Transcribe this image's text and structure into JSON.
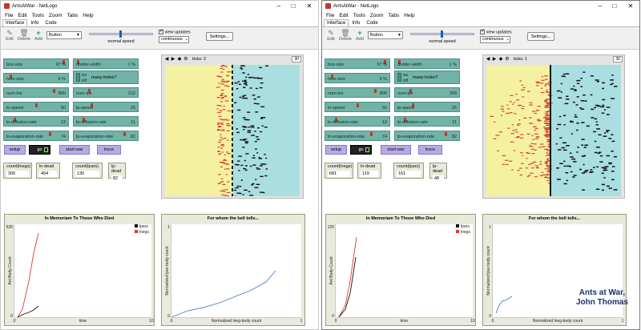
{
  "left": {
    "title": "AntsAtWar - NetLogo",
    "menu": [
      "File",
      "Edit",
      "Tools",
      "Zoom",
      "Tabs",
      "Help"
    ],
    "tabs": [
      "Interface",
      "Info",
      "Code"
    ],
    "toolbar": {
      "edit": "Edit",
      "delete": "Delete",
      "add": "Add",
      "widget_type": "Button",
      "speed_label": "normal speed",
      "view_updates": "view updates",
      "update_mode": "continuous",
      "settings": "Settings..."
    },
    "sliders": [
      {
        "name": "box-size",
        "value": "97 %",
        "level": 0.97
      },
      {
        "name": "hole-size",
        "value": "5 %",
        "level": 0.05
      },
      {
        "name": "num-lns",
        "value": "800",
        "level": 0.8
      },
      {
        "name": "ln-speed",
        "value": "50",
        "level": 0.5
      },
      {
        "name": "ln-diffusion-rate",
        "value": "13",
        "level": 0.13
      },
      {
        "name": "ln-evaporation-rate",
        "value": "74",
        "level": 0.74
      },
      {
        "name": "divider-width",
        "value": "1 %",
        "level": 0.01
      },
      {
        "name": "num-lps",
        "value": "212",
        "level": 0.21
      },
      {
        "name": "lp-speed",
        "value": "25",
        "level": 0.25
      },
      {
        "name": "lp-diffusion-rate",
        "value": "11",
        "level": 0.11
      },
      {
        "name": "lp-evaporation-rate",
        "value": "82",
        "level": 0.82
      }
    ],
    "switch": {
      "on": "On",
      "off": "Off",
      "name": "many-holes?"
    },
    "buttons": {
      "setup": "setup",
      "go": "go",
      "start_war": "start-war",
      "truce": "truce"
    },
    "monitors": [
      {
        "label": "count(lnegs)",
        "value": "306"
      },
      {
        "label": "ln-dead",
        "value": "494"
      },
      {
        "label": "count(lpars)",
        "value": "130"
      },
      {
        "label": "lp-dead",
        "value": "82"
      }
    ],
    "view": {
      "ticks_label": "ticks: 2",
      "zoom": "30"
    },
    "plot1": {
      "title": "In Memoriam To Those Who Died",
      "ylabel": "Ant Body-Count",
      "xlabel": "time",
      "ymax": "535",
      "ymin": "0",
      "xmin": "0",
      "xmax": "10",
      "legend": [
        "lpars",
        "lnegs"
      ]
    },
    "plot2": {
      "title": "For whom the bell tolls...",
      "ylabel": "Normalized lpar-body count",
      "xlabel": "Normalized lneg-body count",
      "ymax": "1",
      "ymin": "0",
      "xmin": "0",
      "xmax": "1"
    }
  },
  "right": {
    "title": "AntsAtWar - NetLogo",
    "menu": [
      "File",
      "Edit",
      "Tools",
      "Zoom",
      "Tabs",
      "Help"
    ],
    "tabs": [
      "Interface",
      "Info",
      "Code"
    ],
    "toolbar": {
      "edit": "Edit",
      "delete": "Delete",
      "add": "Add",
      "widget_type": "Button",
      "speed_label": "normal speed",
      "view_updates": "view updates",
      "update_mode": "continuous",
      "settings": "Settings..."
    },
    "sliders": [
      {
        "name": "box-size",
        "value": "97 %",
        "level": 0.97
      },
      {
        "name": "hole-size",
        "value": "5 %",
        "level": 0.05
      },
      {
        "name": "num-lns",
        "value": "800",
        "level": 0.8
      },
      {
        "name": "ln-speed",
        "value": "50",
        "level": 0.5
      },
      {
        "name": "ln-diffusion-rate",
        "value": "13",
        "level": 0.13
      },
      {
        "name": "ln-evaporation-rate",
        "value": "74",
        "level": 0.74
      },
      {
        "name": "divider-width",
        "value": "1 %",
        "level": 0.01
      },
      {
        "name": "num-lps",
        "value": "209",
        "level": 0.21
      },
      {
        "name": "lp-speed",
        "value": "25",
        "level": 0.25
      },
      {
        "name": "lp-diffusion-rate",
        "value": "11",
        "level": 0.11
      },
      {
        "name": "lp-evaporation-rate",
        "value": "82",
        "level": 0.82
      }
    ],
    "switch": {
      "on": "On",
      "off": "Off",
      "name": "many-holes?"
    },
    "buttons": {
      "setup": "setup",
      "go": "go",
      "start_war": "start-war",
      "truce": "truce"
    },
    "monitors": [
      {
        "label": "count(lnegs)",
        "value": "681"
      },
      {
        "label": "ln-dead",
        "value": "119"
      },
      {
        "label": "count(lpars)",
        "value": "161"
      },
      {
        "label": "lp-dead",
        "value": "48"
      }
    ],
    "view": {
      "ticks_label": "ticks: 1",
      "zoom": "30"
    },
    "plot1": {
      "title": "In Memoriam To Those Who Died",
      "ylabel": "Ant Body-Count",
      "xlabel": "time",
      "ymax": "120",
      "ymin": "0",
      "xmin": "0",
      "xmax": "10",
      "legend": [
        "lpars",
        "lnegs"
      ]
    },
    "plot2": {
      "title": "For whom the bell tolls...",
      "ylabel": "Normalized lpar-body count",
      "xlabel": "Normalized lneg-body count",
      "ymax": "1",
      "ymin": "0",
      "xmin": "0",
      "xmax": "1"
    }
  },
  "caption": {
    "line1": "Ants at War,",
    "line2": "John Thomas"
  },
  "colors": {
    "slider": "#72b3a8",
    "button": "#b6a9e6",
    "monitor": "#e9eadc",
    "patch_yellow": "#f4f1a0",
    "patch_cyan": "#a9dfe0",
    "ant_red": "#d9463b",
    "lneg_line": "#e03a2f",
    "lpar_line": "#111111",
    "ratio_line": "#4a78c2"
  }
}
